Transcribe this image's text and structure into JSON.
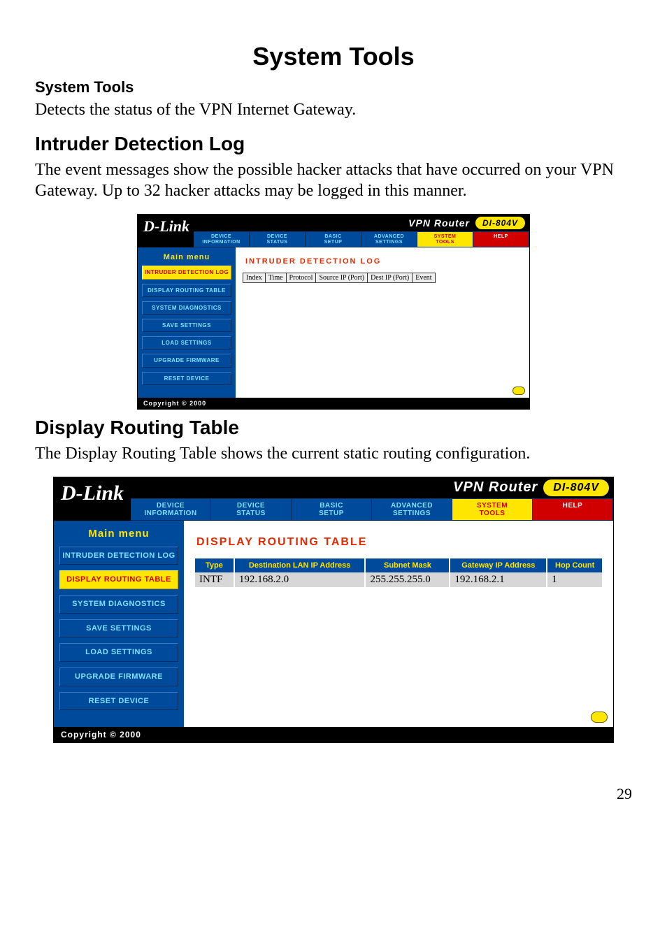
{
  "doc": {
    "title": "System Tools",
    "subhead": "System Tools",
    "para1": "Detects the status of the VPN Internet Gateway.",
    "section1": "Intruder Detection Log",
    "para2": "The event messages show the possible hacker attacks that have occurred on your VPN Gateway.  Up to 32 hacker attacks may be logged in this manner.",
    "section2": "Display Routing Table",
    "para3": "The Display Routing Table shows the current static routing configuration.",
    "page_number": "29"
  },
  "router": {
    "brand": "D-Link",
    "vpn_title": "VPN Router",
    "model": "DI-804V",
    "copyright": "Copyright © 2000",
    "tabs": [
      {
        "l1": "DEVICE",
        "l2": "INFORMATION"
      },
      {
        "l1": "DEVICE",
        "l2": "STATUS"
      },
      {
        "l1": "BASIC",
        "l2": "SETUP"
      },
      {
        "l1": "ADVANCED",
        "l2": "SETTINGS"
      },
      {
        "l1": "SYSTEM",
        "l2": "TOOLS"
      },
      {
        "l1": "HELP",
        "l2": ""
      }
    ],
    "main_menu_label": "Main menu",
    "sidebar": [
      "INTRUDER DETECTION LOG",
      "DISPLAY ROUTING TABLE",
      "SYSTEM DIAGNOSTICS",
      "SAVE SETTINGS",
      "LOAD SETTINGS",
      "UPGRADE FIRMWARE",
      "RESET DEVICE"
    ]
  },
  "panel_a": {
    "heading": "INTRUDER DETECTION LOG",
    "columns": [
      "Index",
      "Time",
      "Protocol",
      "Source IP (Port)",
      "Dest IP (Port)",
      "Event"
    ]
  },
  "panel_b": {
    "heading": "DISPLAY ROUTING TABLE",
    "columns": [
      "Type",
      "Destination LAN IP Address",
      "Subnet Mask",
      "Gateway IP Address",
      "Hop Count"
    ],
    "rows": [
      [
        "INTF",
        "192.168.2.0",
        "255.255.255.0",
        "192.168.2.1",
        "1"
      ]
    ]
  }
}
